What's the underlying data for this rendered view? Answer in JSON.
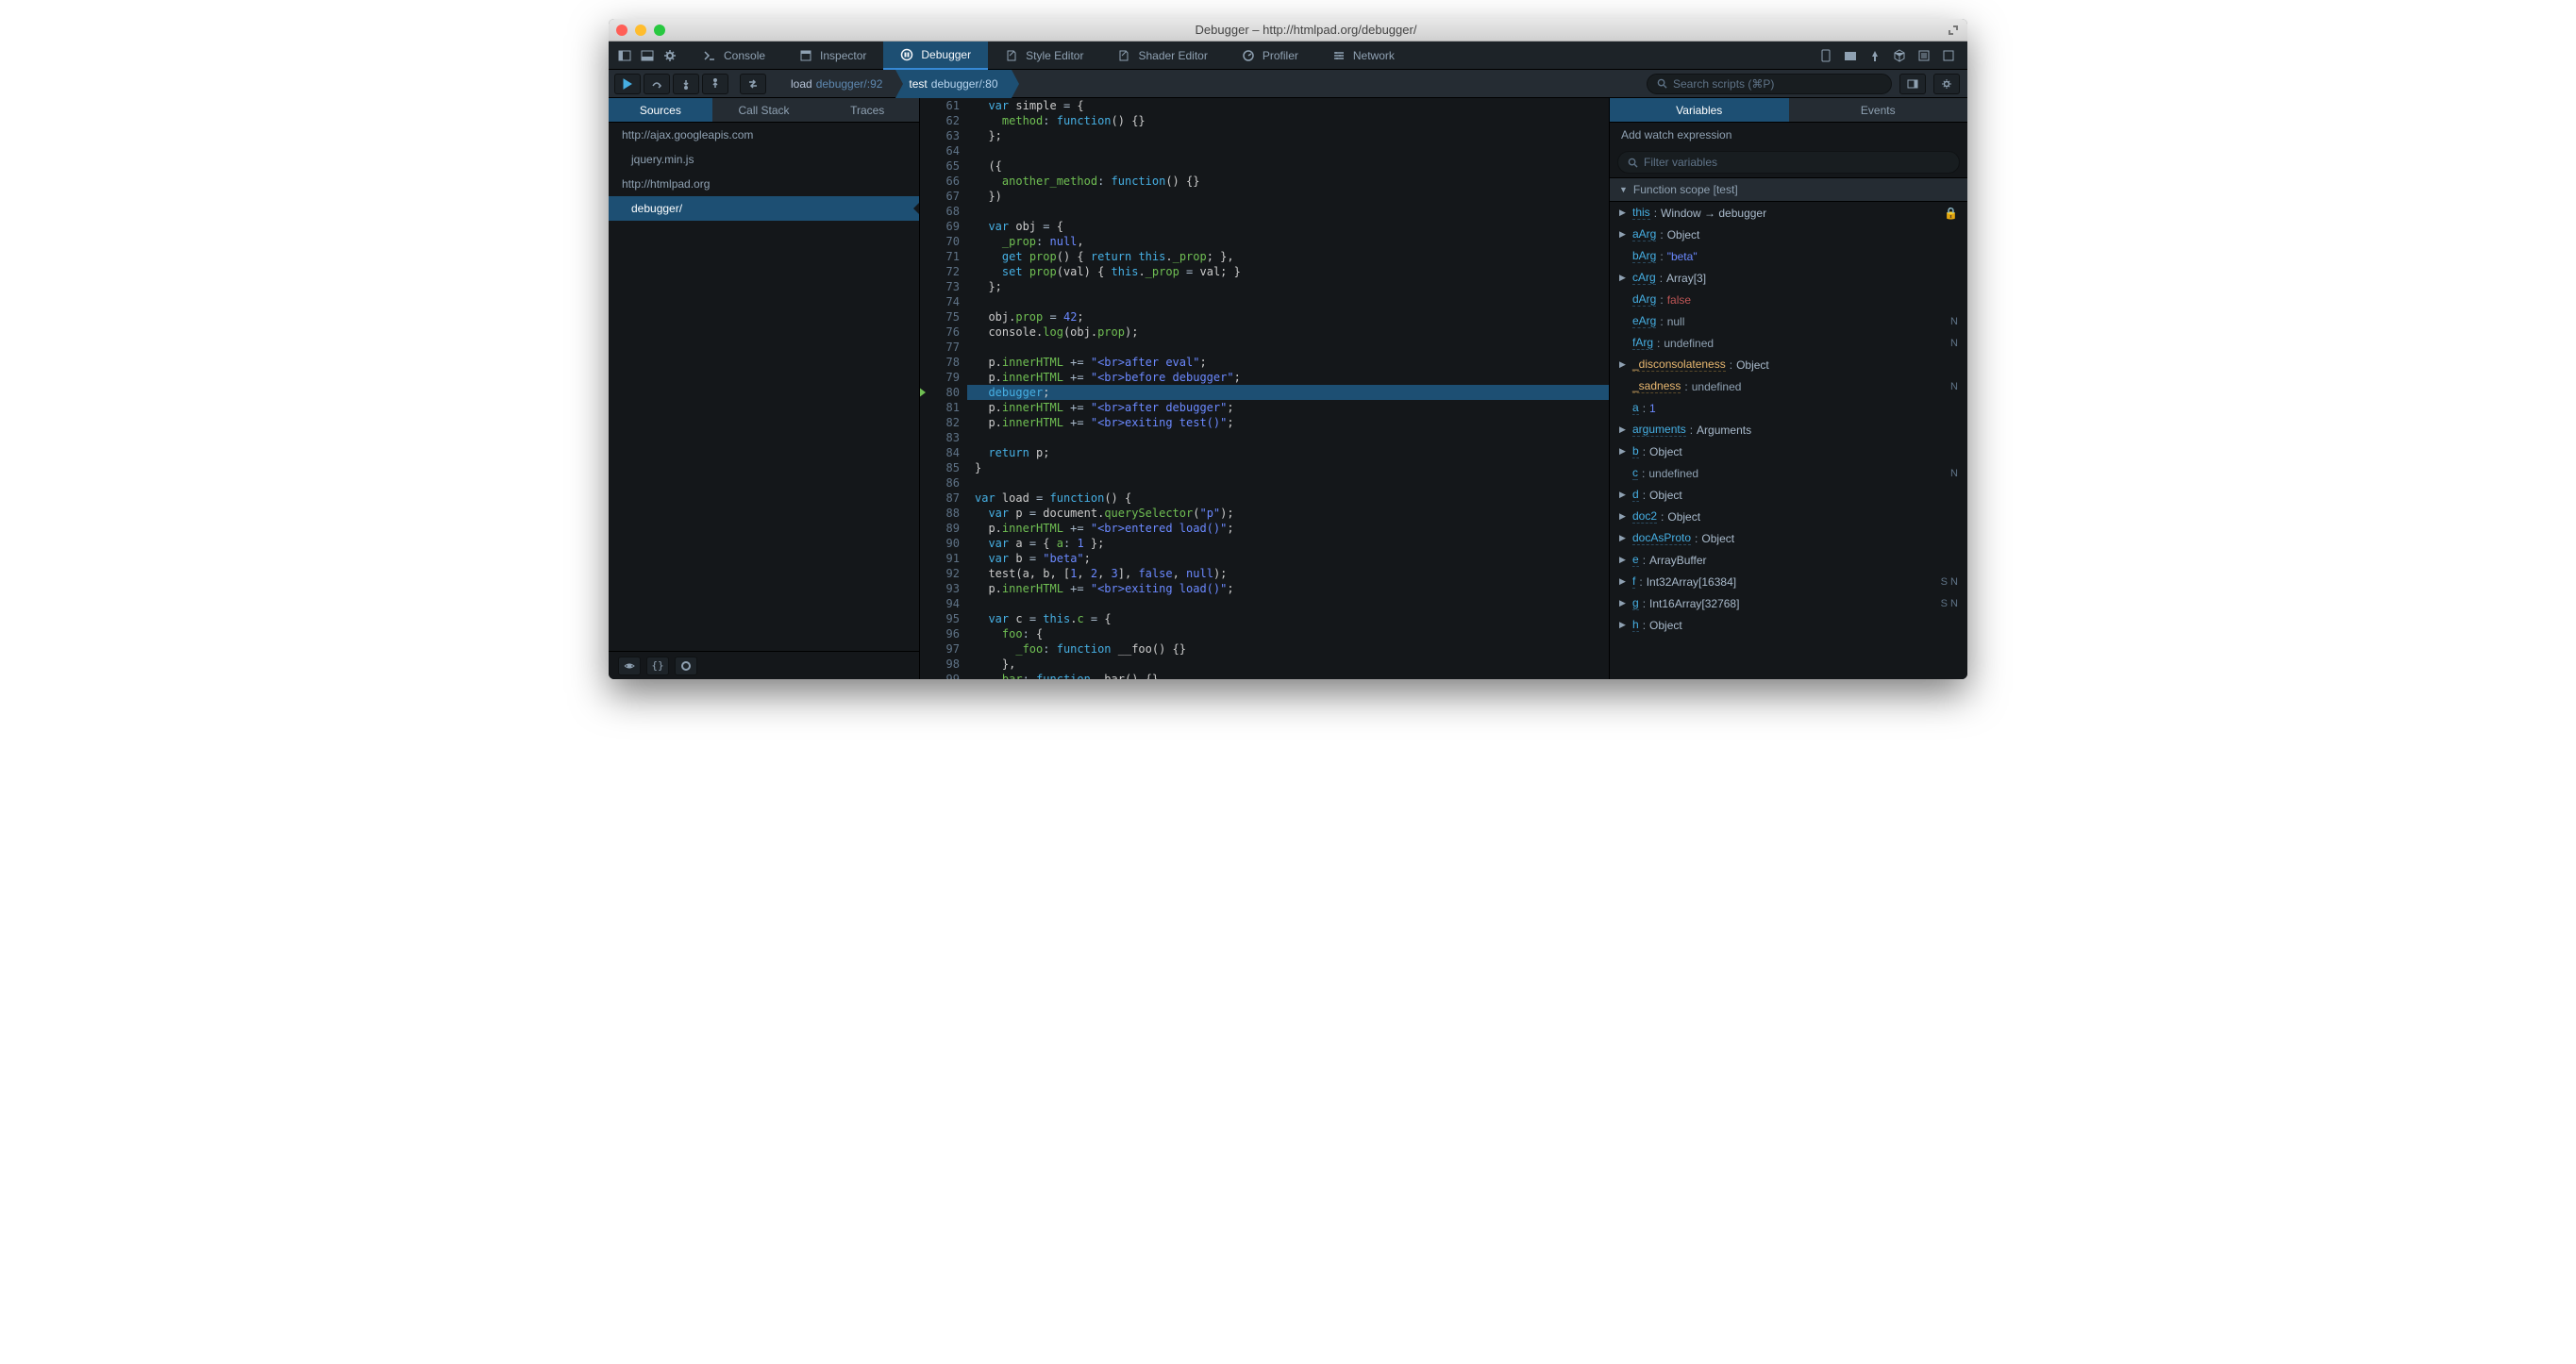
{
  "window": {
    "title": "Debugger – http://htmlpad.org/debugger/"
  },
  "toolbar": {
    "tabs": [
      {
        "label": "Console",
        "icon": "console"
      },
      {
        "label": "Inspector",
        "icon": "inspector"
      },
      {
        "label": "Debugger",
        "icon": "debugger",
        "active": true
      },
      {
        "label": "Style Editor",
        "icon": "style"
      },
      {
        "label": "Shader Editor",
        "icon": "shader"
      },
      {
        "label": "Profiler",
        "icon": "profiler"
      },
      {
        "label": "Network",
        "icon": "network"
      }
    ]
  },
  "frames": [
    {
      "fn": "load",
      "loc": "debugger/:92",
      "active": false
    },
    {
      "fn": "test",
      "loc": "debugger/:80",
      "active": true
    }
  ],
  "search": {
    "placeholder": "Search scripts (⌘P)"
  },
  "sidebarTabs": [
    {
      "label": "Sources",
      "active": true
    },
    {
      "label": "Call Stack",
      "active": false
    },
    {
      "label": "Traces",
      "active": false
    }
  ],
  "sources": [
    {
      "label": "http://ajax.googleapis.com",
      "indent": false,
      "active": false
    },
    {
      "label": "jquery.min.js",
      "indent": true,
      "active": false
    },
    {
      "label": "http://htmlpad.org",
      "indent": false,
      "active": false
    },
    {
      "label": "debugger/",
      "indent": true,
      "active": true
    }
  ],
  "code": {
    "startLine": 61,
    "currentLine": 80,
    "lines": [
      [
        [
          "sp",
          "  "
        ],
        [
          "kw",
          "var"
        ],
        [
          "def",
          " simple "
        ],
        [
          "op",
          "="
        ],
        [
          "def",
          " {"
        ]
      ],
      [
        [
          "sp",
          "    "
        ],
        [
          "prop",
          "method"
        ],
        [
          "op",
          ":"
        ],
        [
          "def",
          " "
        ],
        [
          "kw",
          "function"
        ],
        [
          "def",
          "() {}"
        ]
      ],
      [
        [
          "sp",
          "  "
        ],
        [
          "def",
          "};"
        ]
      ],
      [
        [
          "def",
          ""
        ]
      ],
      [
        [
          "sp",
          "  "
        ],
        [
          "def",
          "({"
        ]
      ],
      [
        [
          "sp",
          "    "
        ],
        [
          "prop",
          "another_method"
        ],
        [
          "op",
          ":"
        ],
        [
          "def",
          " "
        ],
        [
          "kw",
          "function"
        ],
        [
          "def",
          "() {}"
        ]
      ],
      [
        [
          "sp",
          "  "
        ],
        [
          "def",
          "})"
        ]
      ],
      [
        [
          "def",
          ""
        ]
      ],
      [
        [
          "sp",
          "  "
        ],
        [
          "kw",
          "var"
        ],
        [
          "def",
          " obj "
        ],
        [
          "op",
          "="
        ],
        [
          "def",
          " {"
        ]
      ],
      [
        [
          "sp",
          "    "
        ],
        [
          "prop",
          "_prop"
        ],
        [
          "op",
          ":"
        ],
        [
          "def",
          " "
        ],
        [
          "bool",
          "null"
        ],
        [
          "def",
          ","
        ]
      ],
      [
        [
          "sp",
          "    "
        ],
        [
          "kw",
          "get"
        ],
        [
          "def",
          " "
        ],
        [
          "prop",
          "prop"
        ],
        [
          "def",
          "() { "
        ],
        [
          "kw",
          "return"
        ],
        [
          "def",
          " "
        ],
        [
          "kw",
          "this"
        ],
        [
          "def",
          "."
        ],
        [
          "prop",
          "_prop"
        ],
        [
          "def",
          "; },"
        ]
      ],
      [
        [
          "sp",
          "    "
        ],
        [
          "kw",
          "set"
        ],
        [
          "def",
          " "
        ],
        [
          "prop",
          "prop"
        ],
        [
          "def",
          "(val) { "
        ],
        [
          "kw",
          "this"
        ],
        [
          "def",
          "."
        ],
        [
          "prop",
          "_prop"
        ],
        [
          "def",
          " "
        ],
        [
          "op",
          "="
        ],
        [
          "def",
          " val; }"
        ]
      ],
      [
        [
          "sp",
          "  "
        ],
        [
          "def",
          "};"
        ]
      ],
      [
        [
          "def",
          ""
        ]
      ],
      [
        [
          "sp",
          "  "
        ],
        [
          "def",
          "obj."
        ],
        [
          "prop",
          "prop"
        ],
        [
          "def",
          " "
        ],
        [
          "op",
          "="
        ],
        [
          "def",
          " "
        ],
        [
          "num",
          "42"
        ],
        [
          "def",
          ";"
        ]
      ],
      [
        [
          "sp",
          "  "
        ],
        [
          "def",
          "console."
        ],
        [
          "prop",
          "log"
        ],
        [
          "def",
          "(obj."
        ],
        [
          "prop",
          "prop"
        ],
        [
          "def",
          ");"
        ]
      ],
      [
        [
          "def",
          ""
        ]
      ],
      [
        [
          "sp",
          "  "
        ],
        [
          "def",
          "p."
        ],
        [
          "prop",
          "innerHTML"
        ],
        [
          "def",
          " "
        ],
        [
          "op",
          "+="
        ],
        [
          "def",
          " "
        ],
        [
          "str",
          "\"<br>after eval\""
        ],
        [
          "def",
          ";"
        ]
      ],
      [
        [
          "sp",
          "  "
        ],
        [
          "def",
          "p."
        ],
        [
          "prop",
          "innerHTML"
        ],
        [
          "def",
          " "
        ],
        [
          "op",
          "+="
        ],
        [
          "def",
          " "
        ],
        [
          "str",
          "\"<br>before debugger\""
        ],
        [
          "def",
          ";"
        ]
      ],
      [
        [
          "sp",
          "  "
        ],
        [
          "kw",
          "debugger"
        ],
        [
          "def",
          ";"
        ]
      ],
      [
        [
          "sp",
          "  "
        ],
        [
          "def",
          "p."
        ],
        [
          "prop",
          "innerHTML"
        ],
        [
          "def",
          " "
        ],
        [
          "op",
          "+="
        ],
        [
          "def",
          " "
        ],
        [
          "str",
          "\"<br>after debugger\""
        ],
        [
          "def",
          ";"
        ]
      ],
      [
        [
          "sp",
          "  "
        ],
        [
          "def",
          "p."
        ],
        [
          "prop",
          "innerHTML"
        ],
        [
          "def",
          " "
        ],
        [
          "op",
          "+="
        ],
        [
          "def",
          " "
        ],
        [
          "str",
          "\"<br>exiting test()\""
        ],
        [
          "def",
          ";"
        ]
      ],
      [
        [
          "def",
          ""
        ]
      ],
      [
        [
          "sp",
          "  "
        ],
        [
          "kw",
          "return"
        ],
        [
          "def",
          " p;"
        ]
      ],
      [
        [
          "def",
          "}"
        ]
      ],
      [
        [
          "def",
          ""
        ]
      ],
      [
        [
          "kw",
          "var"
        ],
        [
          "def",
          " load "
        ],
        [
          "op",
          "="
        ],
        [
          "def",
          " "
        ],
        [
          "kw",
          "function"
        ],
        [
          "def",
          "() {"
        ]
      ],
      [
        [
          "sp",
          "  "
        ],
        [
          "kw",
          "var"
        ],
        [
          "def",
          " p "
        ],
        [
          "op",
          "="
        ],
        [
          "def",
          " document."
        ],
        [
          "prop",
          "querySelector"
        ],
        [
          "def",
          "("
        ],
        [
          "str",
          "\"p\""
        ],
        [
          "def",
          ");"
        ]
      ],
      [
        [
          "sp",
          "  "
        ],
        [
          "def",
          "p."
        ],
        [
          "prop",
          "innerHTML"
        ],
        [
          "def",
          " "
        ],
        [
          "op",
          "+="
        ],
        [
          "def",
          " "
        ],
        [
          "str",
          "\"<br>entered load()\""
        ],
        [
          "def",
          ";"
        ]
      ],
      [
        [
          "sp",
          "  "
        ],
        [
          "kw",
          "var"
        ],
        [
          "def",
          " a "
        ],
        [
          "op",
          "="
        ],
        [
          "def",
          " { "
        ],
        [
          "prop",
          "a"
        ],
        [
          "op",
          ":"
        ],
        [
          "def",
          " "
        ],
        [
          "num",
          "1"
        ],
        [
          "def",
          " };"
        ]
      ],
      [
        [
          "sp",
          "  "
        ],
        [
          "kw",
          "var"
        ],
        [
          "def",
          " b "
        ],
        [
          "op",
          "="
        ],
        [
          "def",
          " "
        ],
        [
          "str",
          "\"beta\""
        ],
        [
          "def",
          ";"
        ]
      ],
      [
        [
          "sp",
          "  "
        ],
        [
          "def",
          "test(a, b, ["
        ],
        [
          "num",
          "1"
        ],
        [
          "def",
          ", "
        ],
        [
          "num",
          "2"
        ],
        [
          "def",
          ", "
        ],
        [
          "num",
          "3"
        ],
        [
          "def",
          "], "
        ],
        [
          "bool",
          "false"
        ],
        [
          "def",
          ", "
        ],
        [
          "bool",
          "null"
        ],
        [
          "def",
          ");"
        ]
      ],
      [
        [
          "sp",
          "  "
        ],
        [
          "def",
          "p."
        ],
        [
          "prop",
          "innerHTML"
        ],
        [
          "def",
          " "
        ],
        [
          "op",
          "+="
        ],
        [
          "def",
          " "
        ],
        [
          "str",
          "\"<br>exiting load()\""
        ],
        [
          "def",
          ";"
        ]
      ],
      [
        [
          "def",
          ""
        ]
      ],
      [
        [
          "sp",
          "  "
        ],
        [
          "kw",
          "var"
        ],
        [
          "def",
          " c "
        ],
        [
          "op",
          "="
        ],
        [
          "def",
          " "
        ],
        [
          "kw",
          "this"
        ],
        [
          "def",
          "."
        ],
        [
          "prop",
          "c"
        ],
        [
          "def",
          " "
        ],
        [
          "op",
          "="
        ],
        [
          "def",
          " {"
        ]
      ],
      [
        [
          "sp",
          "    "
        ],
        [
          "prop",
          "foo"
        ],
        [
          "op",
          ":"
        ],
        [
          "def",
          " {"
        ]
      ],
      [
        [
          "sp",
          "      "
        ],
        [
          "prop",
          "_foo"
        ],
        [
          "op",
          ":"
        ],
        [
          "def",
          " "
        ],
        [
          "kw",
          "function"
        ],
        [
          "def",
          " __foo() {}"
        ]
      ],
      [
        [
          "sp",
          "    "
        ],
        [
          "def",
          "},"
        ]
      ],
      [
        [
          "sp",
          "    "
        ],
        [
          "prop",
          "bar"
        ],
        [
          "op",
          ":"
        ],
        [
          "def",
          " "
        ],
        [
          "kw",
          "function"
        ],
        [
          "def",
          "  bar() {},"
        ]
      ]
    ]
  },
  "varsTabs": [
    {
      "label": "Variables",
      "active": true
    },
    {
      "label": "Events",
      "active": false
    }
  ],
  "watch": {
    "header": "Add watch expression",
    "filterPlaceholder": "Filter variables"
  },
  "scope": {
    "label": "Function scope [test]"
  },
  "variables": [
    {
      "name": "this",
      "val": "Window → debugger",
      "expandable": true,
      "internal": false,
      "lock": true
    },
    {
      "name": "aArg",
      "val": "Object",
      "expandable": true,
      "internal": false
    },
    {
      "name": "bArg",
      "val": "\"beta\"",
      "valClass": "str",
      "expandable": false,
      "internal": false
    },
    {
      "name": "cArg",
      "val": "Array[3]",
      "expandable": true,
      "internal": false
    },
    {
      "name": "dArg",
      "val": "false",
      "valClass": "bool",
      "expandable": false,
      "internal": false
    },
    {
      "name": "eArg",
      "val": "null",
      "valClass": "null",
      "expandable": false,
      "internal": false,
      "badges": "N"
    },
    {
      "name": "fArg",
      "val": "undefined",
      "valClass": "null",
      "expandable": false,
      "internal": false,
      "badges": "N"
    },
    {
      "name": "_disconsolateness",
      "val": "Object",
      "expandable": true,
      "internal": true
    },
    {
      "name": "_sadness",
      "val": "undefined",
      "valClass": "null",
      "expandable": false,
      "internal": true,
      "badges": "N"
    },
    {
      "name": "a",
      "val": "1",
      "valClass": "str",
      "expandable": false,
      "internal": false
    },
    {
      "name": "arguments",
      "val": "Arguments",
      "expandable": true,
      "internal": false
    },
    {
      "name": "b",
      "val": "Object",
      "expandable": true,
      "internal": false
    },
    {
      "name": "c",
      "val": "undefined",
      "valClass": "null",
      "expandable": false,
      "internal": false,
      "badges": "N"
    },
    {
      "name": "d",
      "val": "Object",
      "expandable": true,
      "internal": false
    },
    {
      "name": "doc2",
      "val": "Object",
      "expandable": true,
      "internal": false
    },
    {
      "name": "docAsProto",
      "val": "Object",
      "expandable": true,
      "internal": false
    },
    {
      "name": "e",
      "val": "ArrayBuffer",
      "expandable": true,
      "internal": false
    },
    {
      "name": "f",
      "val": "Int32Array[16384]",
      "expandable": true,
      "internal": false,
      "badges": "S N"
    },
    {
      "name": "g",
      "val": "Int16Array[32768]",
      "expandable": true,
      "internal": false,
      "badges": "S N"
    },
    {
      "name": "h",
      "val": "Object",
      "expandable": true,
      "internal": false
    }
  ]
}
